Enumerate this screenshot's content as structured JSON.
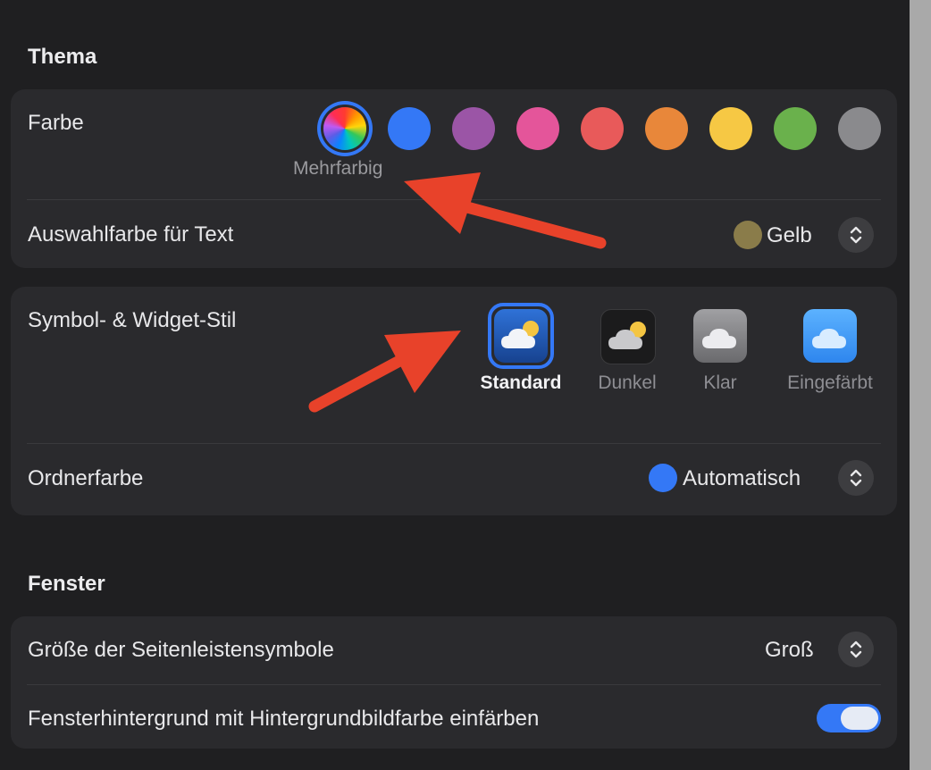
{
  "theme": {
    "title": "Thema",
    "color": {
      "label": "Farbe",
      "selected_caption": "Mehrfarbig",
      "swatches": [
        {
          "name": "multicolor",
          "hex": "conic"
        },
        {
          "name": "blue",
          "hex": "#3478f6"
        },
        {
          "name": "purple",
          "hex": "#9b55a6"
        },
        {
          "name": "pink",
          "hex": "#e4559a"
        },
        {
          "name": "red",
          "hex": "#e85a5a"
        },
        {
          "name": "orange",
          "hex": "#e8873a"
        },
        {
          "name": "yellow",
          "hex": "#f6c844"
        },
        {
          "name": "green",
          "hex": "#6ab14c"
        },
        {
          "name": "graphite",
          "hex": "#8a8a8d"
        }
      ]
    },
    "text_highlight": {
      "label": "Auswahlfarbe für Text",
      "value": "Gelb",
      "dot_color": "#8a7c4a"
    },
    "icon_widget_style": {
      "label": "Symbol- & Widget-Stil",
      "options": [
        "Standard",
        "Dunkel",
        "Klar",
        "Eingefärbt"
      ],
      "selected": "Standard"
    },
    "folder_color": {
      "label": "Ordnerfarbe",
      "value": "Automatisch",
      "dot_color": "#3478f6"
    }
  },
  "window": {
    "title": "Fenster",
    "sidebar_icon_size": {
      "label": "Größe der Seitenleistensymbole",
      "value": "Groß"
    },
    "tint_background": {
      "label": "Fensterhintergrund mit Hintergrundbildfarbe einfärben",
      "enabled": true
    }
  },
  "colors": {
    "accent": "#3478f6",
    "annotation_arrow": "#e8422a"
  }
}
